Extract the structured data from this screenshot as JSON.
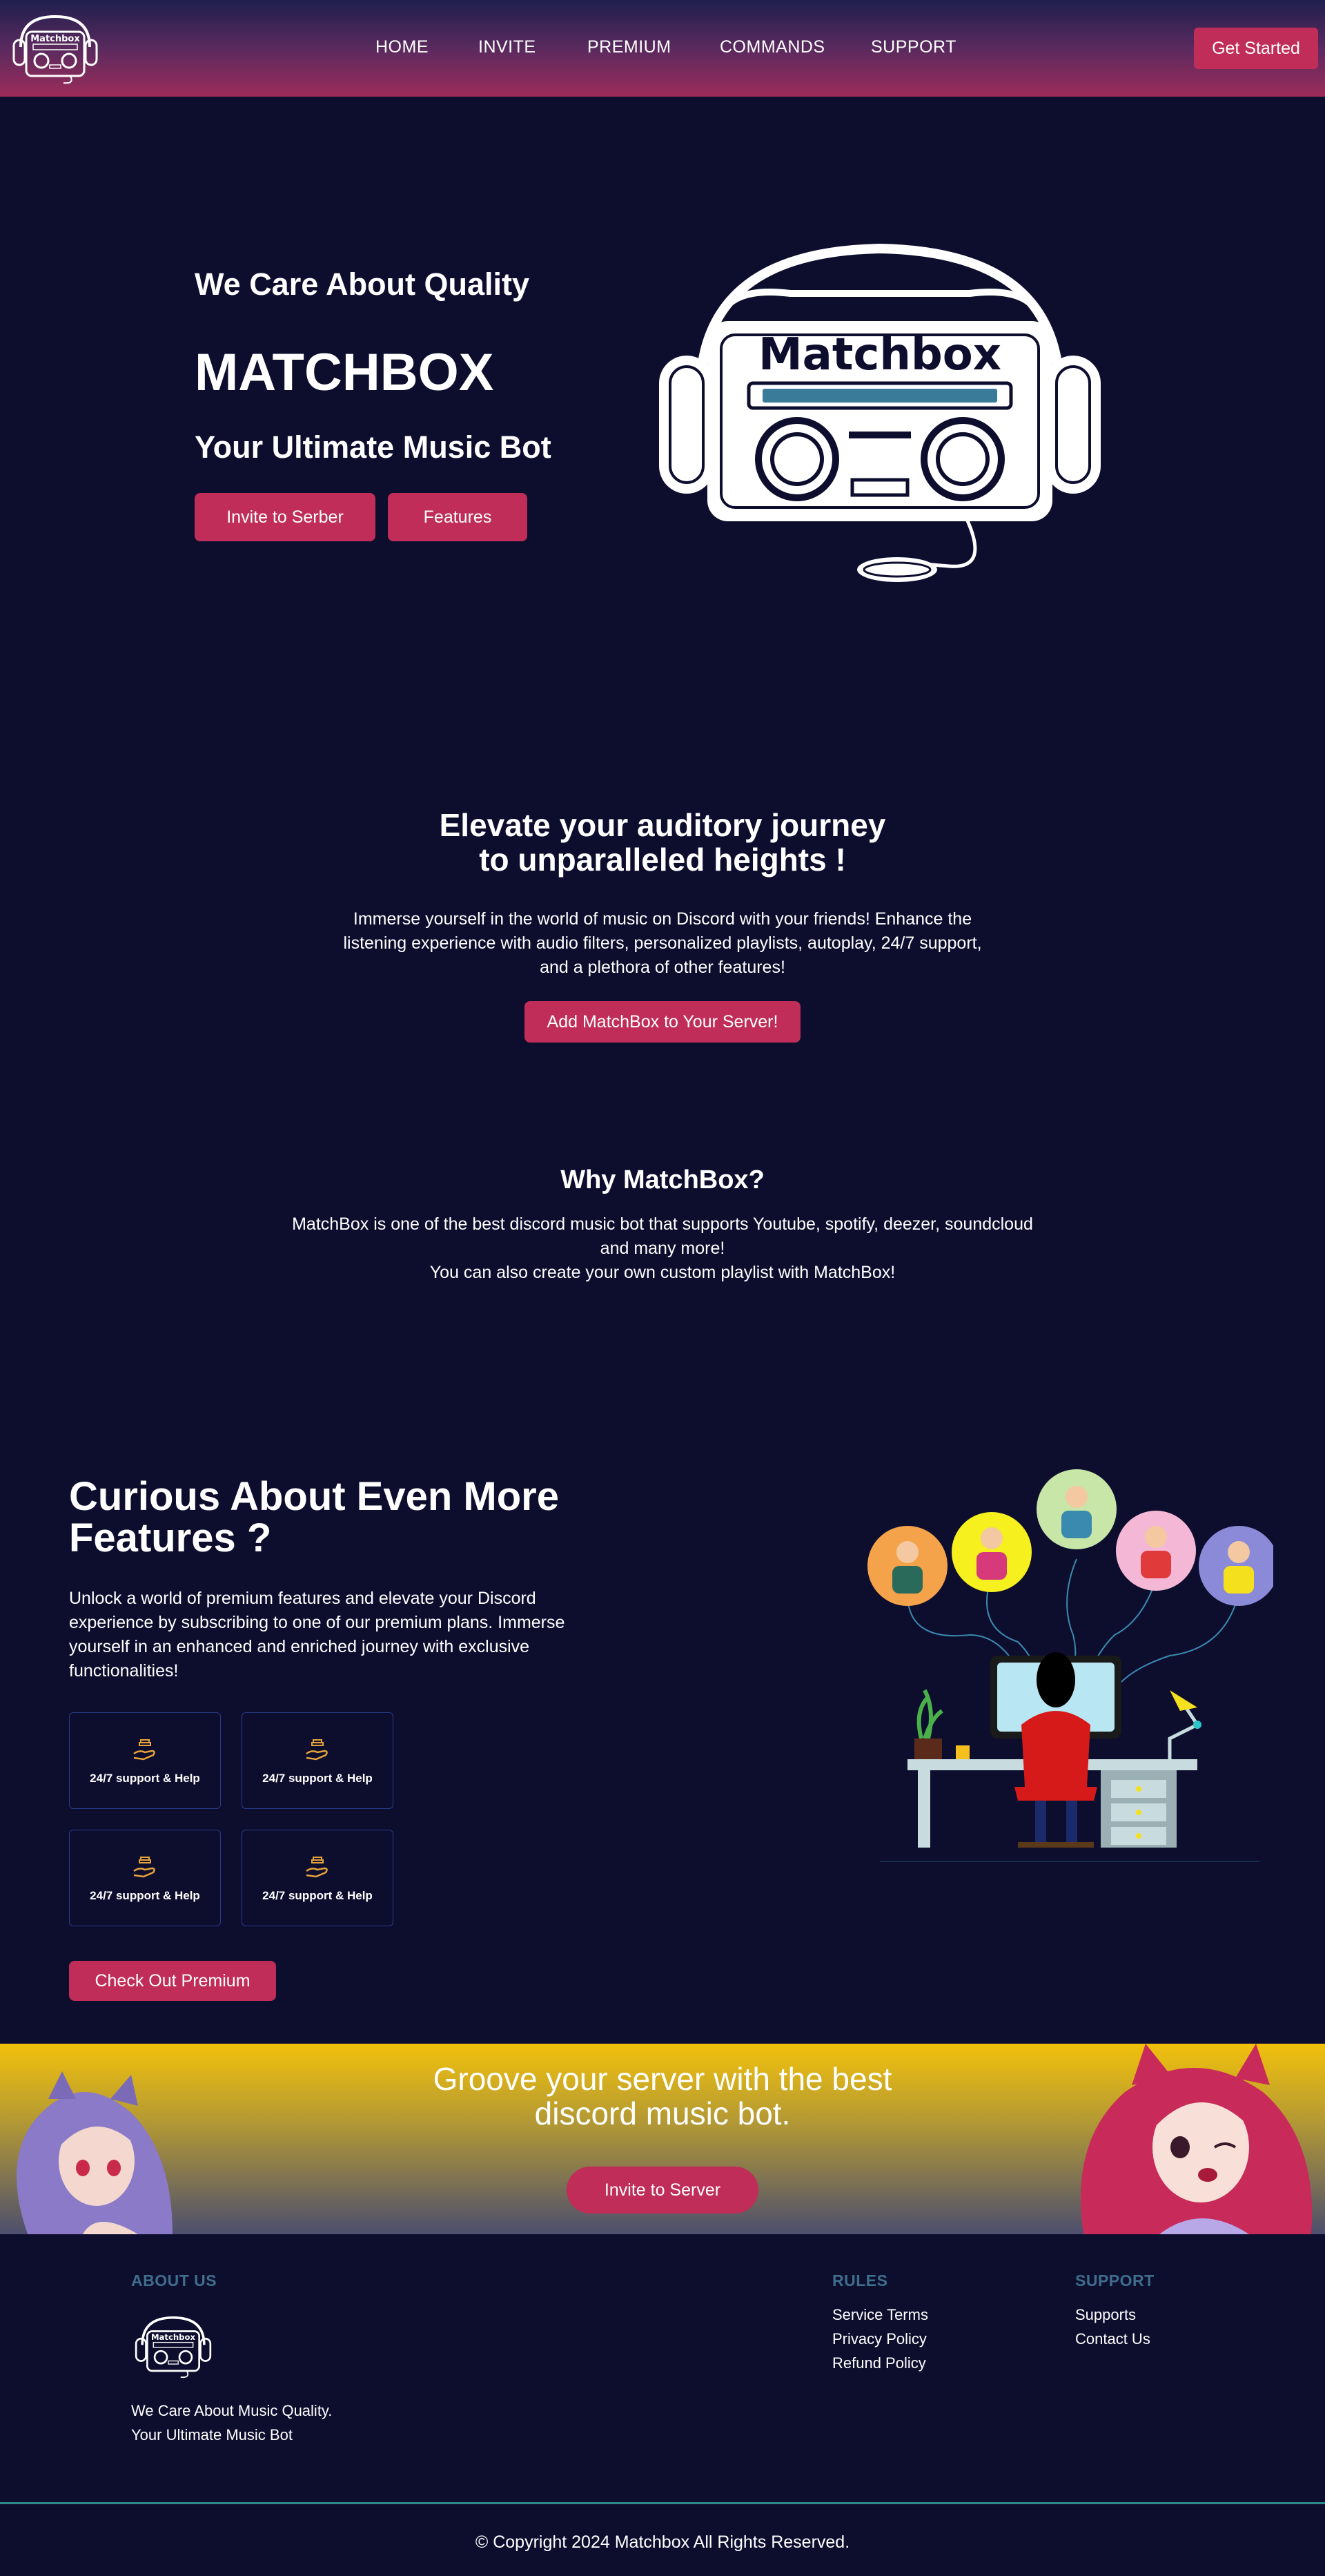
{
  "nav": {
    "logo_text": "Matchbox",
    "links": [
      "HOME",
      "INVITE",
      "PREMIUM",
      "COMMANDS",
      "SUPPORT"
    ],
    "cta": "Get Started"
  },
  "hero": {
    "tagline": "We Care About Quality",
    "title": "MATCHBOX",
    "subtitle": "Your Ultimate Music Bot",
    "invite_button": "Invite to Serber",
    "features_button": "Features",
    "logo_text": "Matchbox"
  },
  "elevate": {
    "title_line1": "Elevate your auditory journey",
    "title_line2": "to unparalleled heights !",
    "text_line1": "Immerse yourself in the world of music on Discord with your friends! Enhance the",
    "text_line2": "listening experience with audio filters, personalized playlists, autoplay, 24/7 support,",
    "text_line3": "and a plethora of other features!",
    "button": "Add MatchBox to Your Server!"
  },
  "why": {
    "title": "Why MatchBox?",
    "text_line1": "MatchBox is one of the best discord music bot that supports Youtube, spotify, deezer, soundcloud",
    "text_line2": "and many more!",
    "text_line3": "You can also create your own custom playlist with MatchBox!"
  },
  "features": {
    "title_line1": "Curious About Even More",
    "title_line2": "Features ?",
    "text_line1": "Unlock a world of premium features and elevate your Discord",
    "text_line2": "experience by subscribing to one of our premium plans. Immerse",
    "text_line3": "yourself in an enhanced and enriched journey with exclusive",
    "text_line4": "functionalities!",
    "cards": [
      "24/7 support & Help",
      "24/7 support & Help",
      "24/7 support & Help",
      "24/7 support & Help"
    ],
    "button": "Check Out Premium"
  },
  "banner": {
    "line1": "Groove your server with the best",
    "line2": "discord music bot.",
    "button": "Invite to Server"
  },
  "footer": {
    "about_head": "ABOUT US",
    "about_line1": "We Care About Music Quality.",
    "about_line2": "Your Ultimate Music Bot",
    "rules_head": "RULES",
    "rules_links": [
      "Service Terms",
      "Privacy Policy",
      "Refund Policy"
    ],
    "support_head": "SUPPORT",
    "support_links": [
      "Supports",
      "Contact Us"
    ],
    "copyright": "© Copyright 2024 Matchbox All Rights Reserved."
  },
  "colors": {
    "background": "#0d0e2e",
    "accent": "#bf2d58",
    "footer_heading": "#3f6d8c",
    "divider": "#2a8a8a",
    "card_border": "#2a3a8a"
  }
}
